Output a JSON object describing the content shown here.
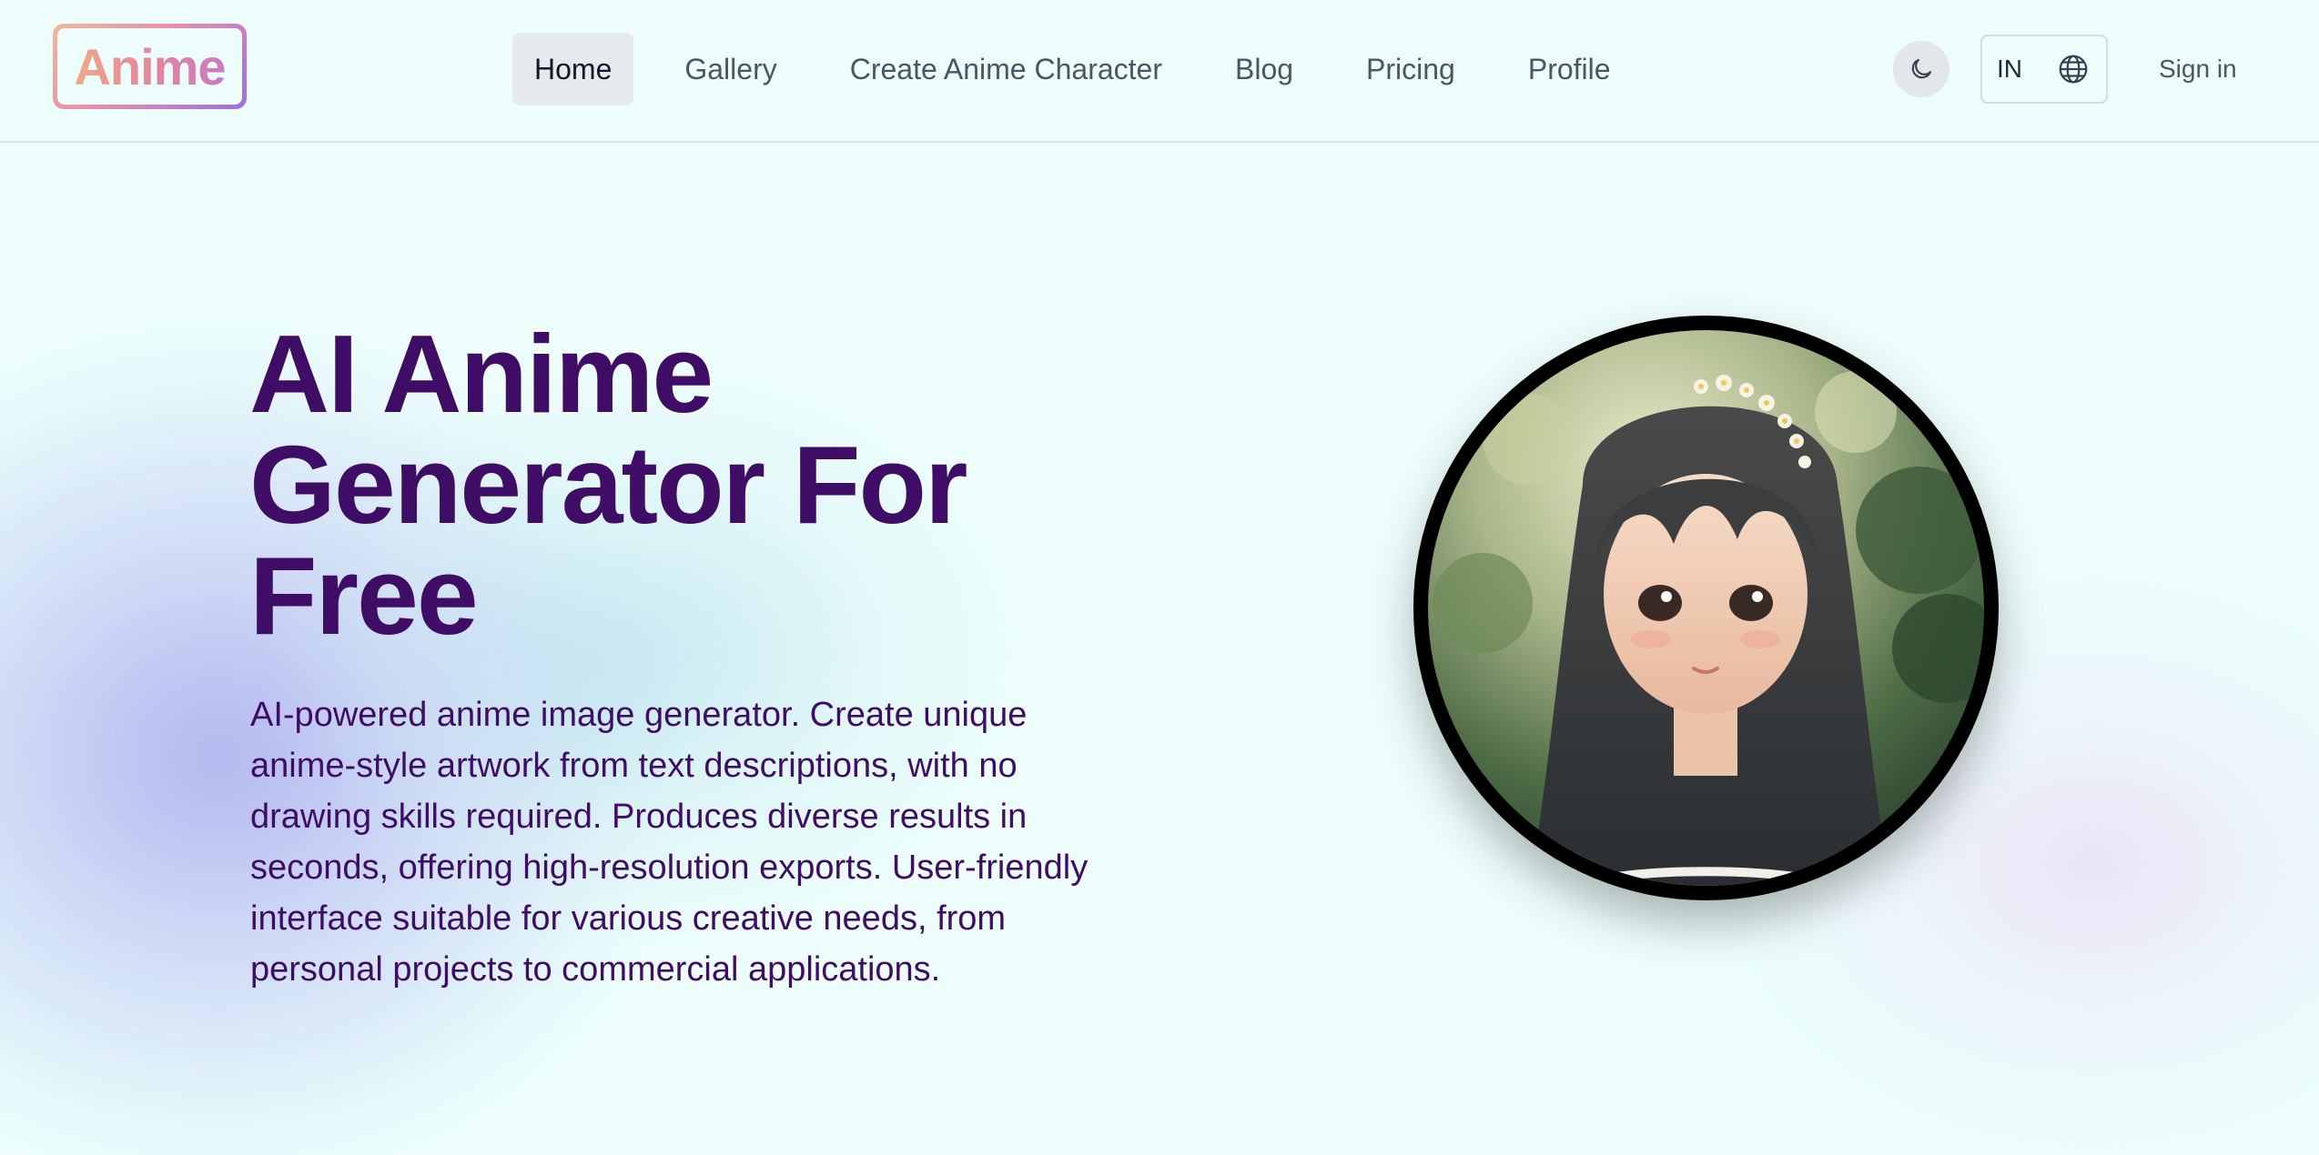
{
  "brand": {
    "logo_text": "Anime"
  },
  "nav": {
    "items": [
      {
        "label": "Home",
        "active": true
      },
      {
        "label": "Gallery"
      },
      {
        "label": "Create Anime Character"
      },
      {
        "label": "Blog"
      },
      {
        "label": "Pricing"
      },
      {
        "label": "Profile"
      }
    ]
  },
  "header_actions": {
    "theme_icon": "moon-icon",
    "language_code": "IN",
    "language_icon": "globe-icon",
    "signin_label": "Sign in"
  },
  "hero": {
    "title": "AI Anime Generator For Free",
    "description": "AI-powered anime image generator. Create unique anime-style artwork from text descriptions, with no drawing skills required. Produces diverse results in seconds, offering high-resolution exports. User-friendly interface suitable for various creative needs, from personal projects to commercial applications.",
    "image_subject": "anime-girl-portrait"
  },
  "colors": {
    "background": "#ecfdfc",
    "heading": "#3f0d66",
    "nav_text": "#4b5563",
    "nav_active_bg": "#e7eaed"
  }
}
